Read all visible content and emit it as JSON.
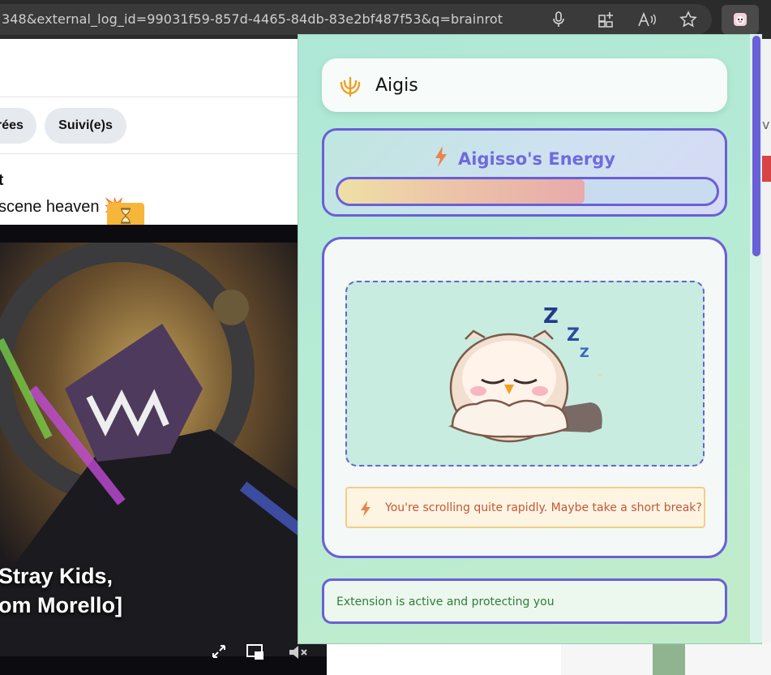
{
  "browser": {
    "url": "348&external_log_id=99031f59-857d-4465-84db-83e2bf487f53&q=brainrot",
    "icons": [
      "microphone-icon",
      "split-screen-icon",
      "read-aloud-icon",
      "favorite-star-icon",
      "extension-icon"
    ]
  },
  "page": {
    "chips": [
      "rées",
      "Suivi(e)s"
    ],
    "post_author": "t",
    "post_text": "scene heaven 💥",
    "video": {
      "caption_line1": "Stray Kids,",
      "caption_line2": "om Morello]",
      "controls": [
        "fullscreen-icon",
        "picture-in-picture-icon",
        "mute-icon"
      ]
    },
    "right_edge_text": "v"
  },
  "extension": {
    "name": "Aigis",
    "energy_title": "Aigisso's Energy",
    "energy_level": 0.65,
    "warning": "You're scrolling quite rapidly. Maybe take a short break?",
    "status": "Extension is active and protecting you",
    "colors": {
      "accent": "#6a5fd8",
      "warning_text": "#c5563a",
      "status_text": "#2f7d3a",
      "bolt": "#e8844f"
    }
  }
}
